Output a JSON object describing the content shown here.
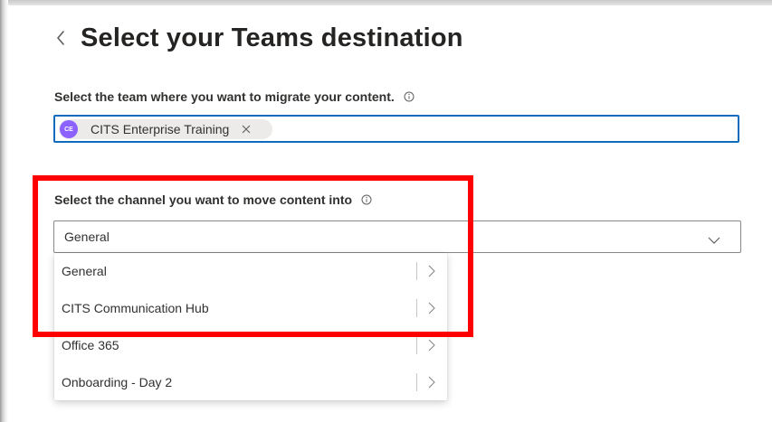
{
  "header": {
    "title": "Select your Teams destination"
  },
  "team_section": {
    "label": "Select the team where you want to migrate your content.",
    "selected_team": {
      "initials": "CE",
      "name": "CITS Enterprise Training"
    }
  },
  "channel_section": {
    "label": "Select the channel you want to move content into",
    "selected_value": "General",
    "options": [
      {
        "label": "General"
      },
      {
        "label": "CITS Communication Hub"
      },
      {
        "label": "Office 365"
      },
      {
        "label": "Onboarding - Day 2"
      }
    ]
  },
  "colors": {
    "accent": "#0f6cbd",
    "avatar": "#8b61ff",
    "highlight_box": "#ff0000"
  },
  "icons": {
    "back": "chevron-left-icon",
    "info": "info-icon",
    "remove": "close-icon",
    "dropdown": "chevron-down-icon",
    "drill_in": "chevron-right-icon"
  }
}
